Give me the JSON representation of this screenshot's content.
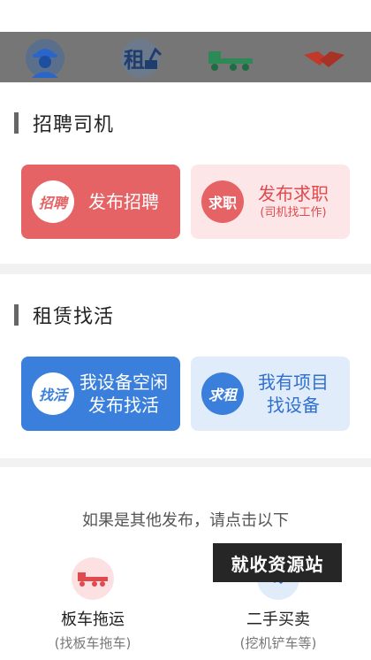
{
  "top_icons": [
    {
      "name": "driver-worker-icon"
    },
    {
      "name": "rent-excavator-icon",
      "text": "租"
    },
    {
      "name": "flatbed-truck-icon"
    },
    {
      "name": "handshake-icon"
    }
  ],
  "recruit": {
    "title": "招聘司机",
    "post_job": {
      "badge": "招聘",
      "label": "发布招聘"
    },
    "seek_job": {
      "badge": "求职",
      "label": "发布求职",
      "sub": "(司机找工作)"
    }
  },
  "rental": {
    "title": "租赁找活",
    "find_work": {
      "badge": "找活",
      "line1": "我设备空闲",
      "line2": "发布找活"
    },
    "find_equipment": {
      "badge": "求租",
      "line1": "我有项目",
      "line2": "找设备"
    }
  },
  "other": {
    "hint": "如果是其他发布，请点击以下",
    "items": [
      {
        "label": "板车拖运",
        "note": "(找板车拖车)"
      },
      {
        "label": "二手买卖",
        "note": "(挖机铲车等)"
      }
    ]
  },
  "watermark": "就收资源站",
  "colors": {
    "red": "#e56365",
    "blue": "#3a7fdc",
    "overlay": "#767676"
  }
}
